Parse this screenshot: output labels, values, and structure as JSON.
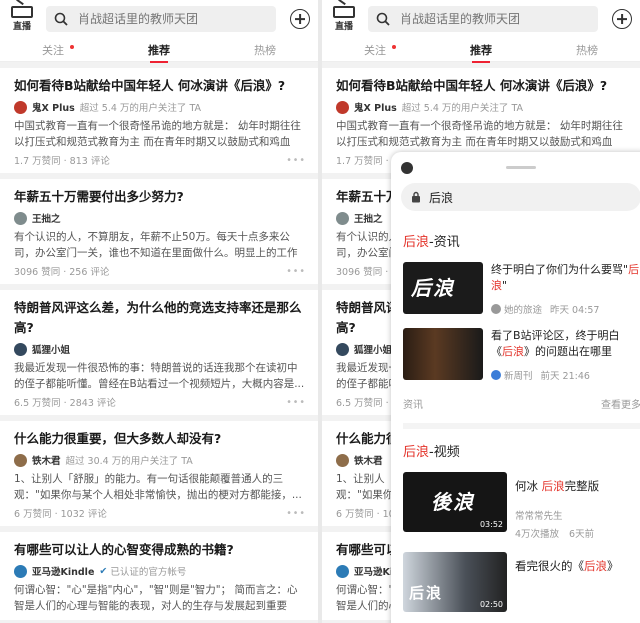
{
  "top": {
    "live_label": "直播",
    "search_placeholder": "肖战超话里的教师天团"
  },
  "tabs": [
    {
      "label": "关注",
      "dot": true
    },
    {
      "label": "推荐",
      "active": true
    },
    {
      "label": "热榜"
    }
  ],
  "feed": [
    {
      "question": "如何看待B站献给中国年轻人 何冰演讲《后浪》?",
      "author": "鬼X Plus",
      "follow": "超过 5.4 万的用户关注了 TA",
      "excerpt": "中国式教育一直有一个很奇怪吊诡的地方就是：  幼年时期往往以打压式和规范式教育为主 而在青年时期又以鼓励式和鸡血式...",
      "stats": "1.7 万赞同 · 813 评论",
      "avatar_color": "#c0392b"
    },
    {
      "question": "年薪五十万需要付出多少努力?",
      "author": "王拙之",
      "follow": "",
      "excerpt": "有个认识的人，不算朋友，年薪不止50万。每天十点多来公司，办公室门一关，谁也不知道在里面做什么。明显上的工作内...",
      "stats": "3096 赞同 · 256 评论",
      "avatar_color": "#7f8c8d"
    },
    {
      "question": "特朗普风评这么差，为什么他的竞选支持率还是那么高?",
      "author": "狐狸小姐",
      "follow": "",
      "excerpt": "我最近发现一件很恐怖的事：特朗普说的话连我那个在读初中的侄子都能听懂。曾经在B站看过一个视频短片，大概内容是...",
      "stats": "6.5 万赞同 · 2843 评论",
      "avatar_color": "#34495e"
    },
    {
      "question": "什么能力很重要，但大多数人却没有?",
      "author": "铁木君",
      "follow": "超过 30.4 万的用户关注了 TA",
      "excerpt": "1、让别人「舒服」的能力。有一句话很能颠覆普通人的三观：\"如果你与某个人相处非常愉快，抛出的梗对方都能接，...",
      "stats": "6 万赞同 · 1032 评论",
      "avatar_color": "#8e6d4a"
    },
    {
      "question": "有哪些可以让人的心智变得成熟的书籍?",
      "author": "亚马逊Kindle",
      "follow": "已认证的官方帐号",
      "excerpt": "何谓心智：\"心\"是指\"内心\"，\"智\"则是\"智力\"；  简而言之：心智是人们的心理与智能的表现，对人的生存与发展起到重要作...",
      "stats": "",
      "avatar_color": "#2c7bb6"
    }
  ],
  "popup": {
    "search_text": "后浪",
    "keyword": "后浪",
    "news_section": "-资讯",
    "news": [
      {
        "title_pre": "终于明白了你们为什么要骂\"",
        "title_kw": "后浪",
        "title_post": "\"",
        "source": "她的旅途",
        "time": "昨天 04:57",
        "thumb_text": "后浪"
      },
      {
        "title_pre": "看了B站评论区，终于明白《",
        "title_kw": "后浪",
        "title_post": "》的问题出在哪里",
        "source": "新周刊",
        "time": "前天 21:46",
        "thumb_text": ""
      }
    ],
    "news_footer_left": "资讯",
    "news_footer_right": "查看更多",
    "video_section": "-视频",
    "videos": [
      {
        "title_pre": "何冰 ",
        "title_kw": "后浪",
        "title_post": "完整版",
        "meta1": "常常常先生",
        "meta2": "4万次播放",
        "meta3": "6天前",
        "duration": "03:52",
        "thumb_text": "後浪"
      },
      {
        "title_pre": "看完很火的《",
        "title_kw": "后浪",
        "title_post": "》",
        "meta1": "",
        "meta2": "",
        "meta3": "",
        "duration": "02:50",
        "thumb_text": "后浪"
      }
    ]
  }
}
